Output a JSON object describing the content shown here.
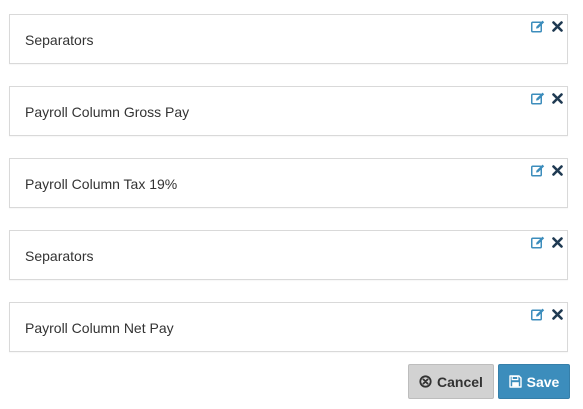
{
  "items": [
    {
      "label": "Separators",
      "edit_icon": "edit-icon",
      "remove_icon": "remove-icon"
    },
    {
      "label": "Payroll Column Gross Pay",
      "edit_icon": "edit-icon",
      "remove_icon": "remove-icon"
    },
    {
      "label": "Payroll Column Tax 19%",
      "edit_icon": "edit-icon",
      "remove_icon": "remove-icon"
    },
    {
      "label": "Separators",
      "edit_icon": "edit-icon",
      "remove_icon": "remove-icon"
    },
    {
      "label": "Payroll Column Net Pay",
      "edit_icon": "edit-icon",
      "remove_icon": "remove-icon"
    }
  ],
  "actions": {
    "cancel_label": "Cancel",
    "cancel_icon": "times-circle-icon",
    "save_label": "Save",
    "save_icon": "floppy-disk-icon"
  },
  "colors": {
    "icon_blue": "#3c8dbc",
    "icon_dark": "#1f3a52",
    "save_bg": "#3c8dbc",
    "cancel_bg": "#d2d2d2",
    "border": "#d9d9d9"
  }
}
